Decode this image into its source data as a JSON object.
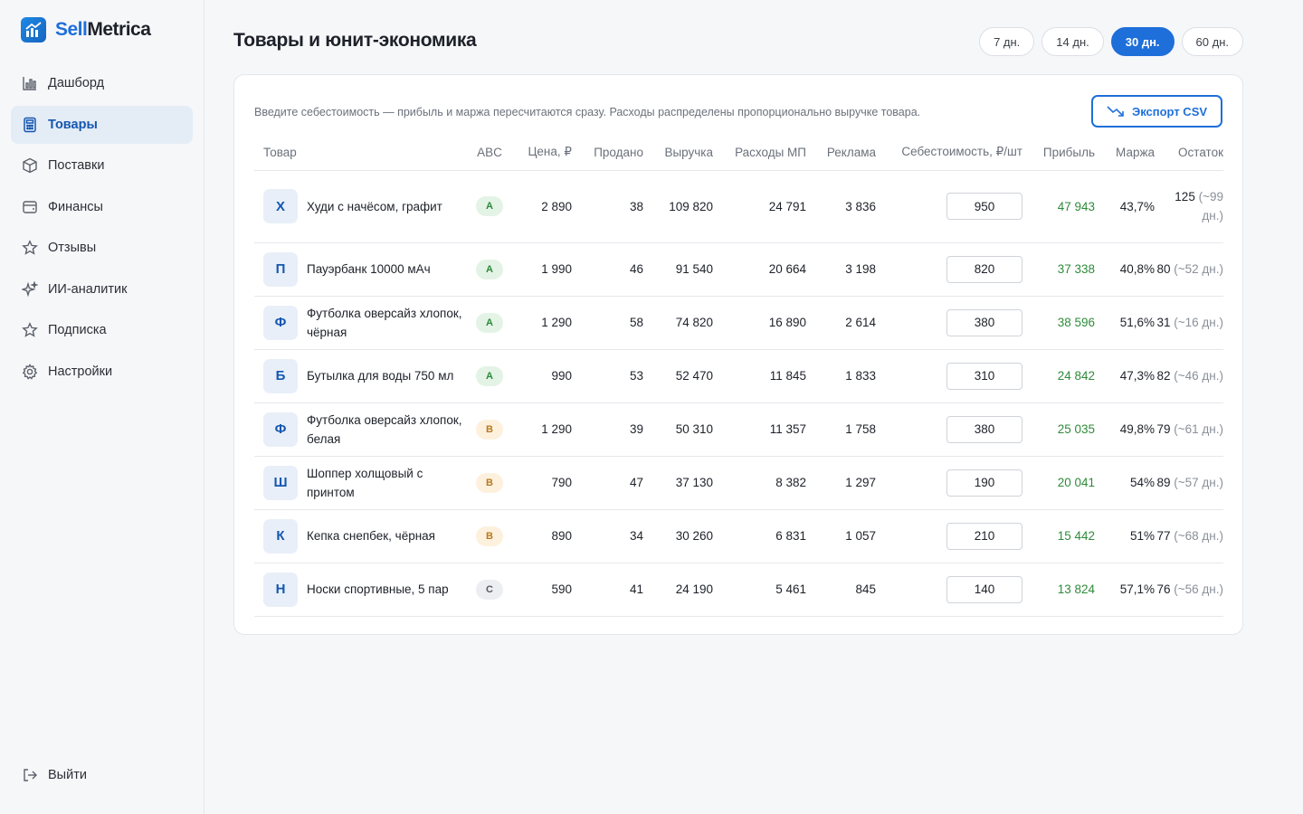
{
  "brand": {
    "part1": "Sell",
    "part2": "Metrica"
  },
  "nav": [
    {
      "label": "Дашборд",
      "icon": "chart-bar-icon",
      "active": false
    },
    {
      "label": "Товары",
      "icon": "calculator-icon",
      "active": true
    },
    {
      "label": "Поставки",
      "icon": "box-icon",
      "active": false
    },
    {
      "label": "Финансы",
      "icon": "wallet-icon",
      "active": false
    },
    {
      "label": "Отзывы",
      "icon": "star-icon",
      "active": false
    },
    {
      "label": "ИИ-аналитик",
      "icon": "sparkles-icon",
      "active": false
    },
    {
      "label": "Подписка",
      "icon": "star-icon",
      "active": false
    },
    {
      "label": "Настройки",
      "icon": "gear-icon",
      "active": false
    }
  ],
  "logout_label": "Выйти",
  "page_title": "Товары и юнит-экономика",
  "periods": [
    {
      "label": "7 дн.",
      "active": false
    },
    {
      "label": "14 дн.",
      "active": false
    },
    {
      "label": "30 дн.",
      "active": true
    },
    {
      "label": "60 дн.",
      "active": false
    }
  ],
  "hint": "Введите себестоимость — прибыль и маржа пересчитаются сразу. Расходы распределены пропорционально выручке товара.",
  "export_label": "Экспорт CSV",
  "colors": {
    "accent": "#1e6fd9",
    "profit": "#2e8b3a",
    "abc_a": "#2c8a3a",
    "abc_b": "#b7791f"
  },
  "columns": [
    "Товар",
    "ABC",
    "Цена, ₽",
    "Продано",
    "Выручка",
    "Расходы МП",
    "Реклама",
    "Себестоимость, ₽/шт",
    "Прибыль",
    "Маржа",
    "Остаток"
  ],
  "rows": [
    {
      "initial": "Х",
      "name": "Худи с начёсом, графит",
      "abc": "A",
      "price": "2 890",
      "sold": "38",
      "revenue": "109 820",
      "mp": "24 791",
      "ads": "3 836",
      "cost": "950",
      "profit": "47 943",
      "margin": "43,7%",
      "stock": "125",
      "days": "(~99 дн.)"
    },
    {
      "initial": "П",
      "name": "Пауэрбанк 10000 мАч",
      "abc": "A",
      "price": "1 990",
      "sold": "46",
      "revenue": "91 540",
      "mp": "20 664",
      "ads": "3 198",
      "cost": "820",
      "profit": "37 338",
      "margin": "40,8%",
      "stock": "80",
      "days": "(~52 дн.)"
    },
    {
      "initial": "Ф",
      "name": "Футболка оверсайз хлопок, чёрная",
      "abc": "A",
      "price": "1 290",
      "sold": "58",
      "revenue": "74 820",
      "mp": "16 890",
      "ads": "2 614",
      "cost": "380",
      "profit": "38 596",
      "margin": "51,6%",
      "stock": "31",
      "days": "(~16 дн.)"
    },
    {
      "initial": "Б",
      "name": "Бутылка для воды 750 мл",
      "abc": "A",
      "price": "990",
      "sold": "53",
      "revenue": "52 470",
      "mp": "11 845",
      "ads": "1 833",
      "cost": "310",
      "profit": "24 842",
      "margin": "47,3%",
      "stock": "82",
      "days": "(~46 дн.)"
    },
    {
      "initial": "Ф",
      "name": "Футболка оверсайз хлопок, белая",
      "abc": "B",
      "price": "1 290",
      "sold": "39",
      "revenue": "50 310",
      "mp": "11 357",
      "ads": "1 758",
      "cost": "380",
      "profit": "25 035",
      "margin": "49,8%",
      "stock": "79",
      "days": "(~61 дн.)"
    },
    {
      "initial": "Ш",
      "name": "Шоппер холщовый с принтом",
      "abc": "B",
      "price": "790",
      "sold": "47",
      "revenue": "37 130",
      "mp": "8 382",
      "ads": "1 297",
      "cost": "190",
      "profit": "20 041",
      "margin": "54%",
      "stock": "89",
      "days": "(~57 дн.)"
    },
    {
      "initial": "К",
      "name": "Кепка снепбек, чёрная",
      "abc": "B",
      "price": "890",
      "sold": "34",
      "revenue": "30 260",
      "mp": "6 831",
      "ads": "1 057",
      "cost": "210",
      "profit": "15 442",
      "margin": "51%",
      "stock": "77",
      "days": "(~68 дн.)"
    },
    {
      "initial": "Н",
      "name": "Носки спортивные, 5 пар",
      "abc": "C",
      "price": "590",
      "sold": "41",
      "revenue": "24 190",
      "mp": "5 461",
      "ads": "845",
      "cost": "140",
      "profit": "13 824",
      "margin": "57,1%",
      "stock": "76",
      "days": "(~56 дн.)"
    }
  ]
}
